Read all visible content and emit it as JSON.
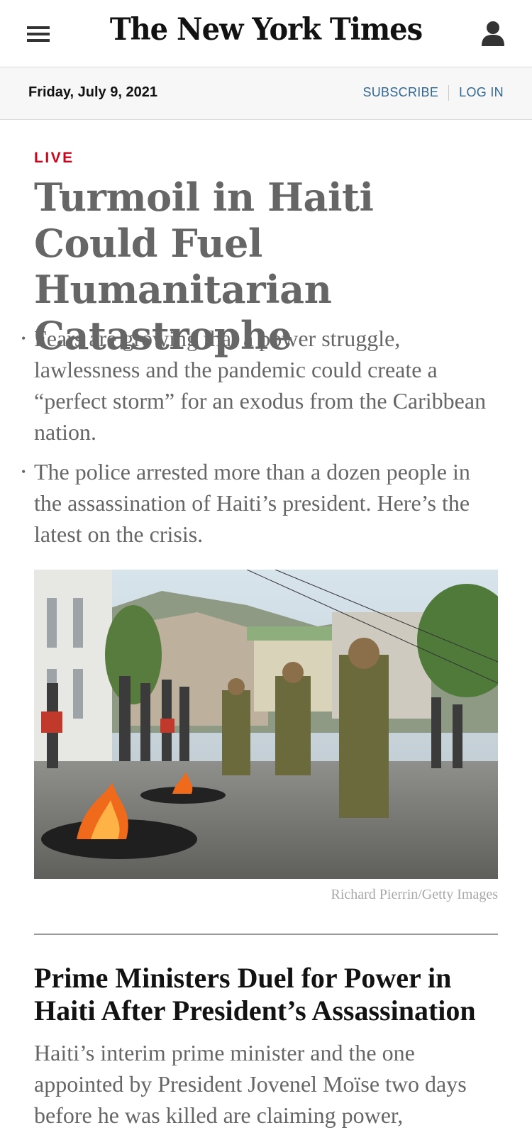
{
  "header": {
    "logo_text": "The New York Times",
    "menu_icon": "hamburger-menu-icon",
    "account_icon": "user-account-icon"
  },
  "datebar": {
    "date": "Friday, July 9, 2021",
    "subscribe": "SUBSCRIBE",
    "login": "LOG IN"
  },
  "lead": {
    "label": "LIVE",
    "headline": "Turmoil in Haiti Could Fuel Humanitarian Catastrophe",
    "bullets": [
      "Fears are growing that a power struggle, lawlessness and the pandemic could create a “perfect storm” for an exodus from the Caribbean nation.",
      "The police arrested more than a dozen people in the assassination of Haiti’s president. Here’s the latest on the crisis."
    ],
    "photo_credit": "Richard Pierrin/Getty Images"
  },
  "story": {
    "headline": "Prime Ministers Duel for Power in Haiti After President’s Assassination",
    "summary": "Haiti’s interim prime minister and the one appointed by President Jovenel Moïse two days before he was killed are claiming power,"
  },
  "colors": {
    "live_red": "#d0021b",
    "link_blue": "#326891",
    "headline_gray": "#666666"
  }
}
